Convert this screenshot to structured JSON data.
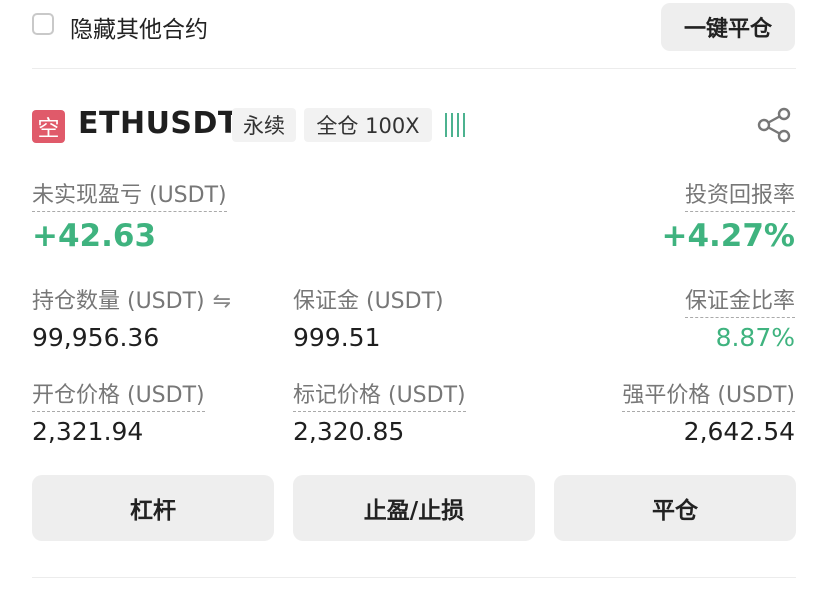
{
  "top_bar": {
    "hide_other_label": "隐藏其他合约",
    "close_all_label": "一键平仓"
  },
  "position": {
    "side": "空",
    "symbol": "ETHUSDT",
    "tags": [
      "永续",
      "全仓 100X"
    ],
    "accent_color": "#3fb37f",
    "short_color": "#e05a6a"
  },
  "stats": {
    "unrealized_pnl": {
      "label": "未实现盈亏 (USDT)",
      "value": "+42.63"
    },
    "roi": {
      "label": "投资回报率",
      "value": "+4.27%"
    },
    "quantity": {
      "label": "持仓数量 (USDT)",
      "value": "99,956.36"
    },
    "margin": {
      "label": "保证金 (USDT)",
      "value": "999.51"
    },
    "margin_ratio": {
      "label": "保证金比率",
      "value": "8.87%"
    },
    "entry_price": {
      "label": "开仓价格 (USDT)",
      "value": "2,321.94"
    },
    "mark_price": {
      "label": "标记价格 (USDT)",
      "value": "2,320.85"
    },
    "liq_price": {
      "label": "强平价格 (USDT)",
      "value": "2,642.54"
    }
  },
  "actions": {
    "leverage": "杠杆",
    "tp_sl": "止盈/止损",
    "close": "平仓"
  }
}
